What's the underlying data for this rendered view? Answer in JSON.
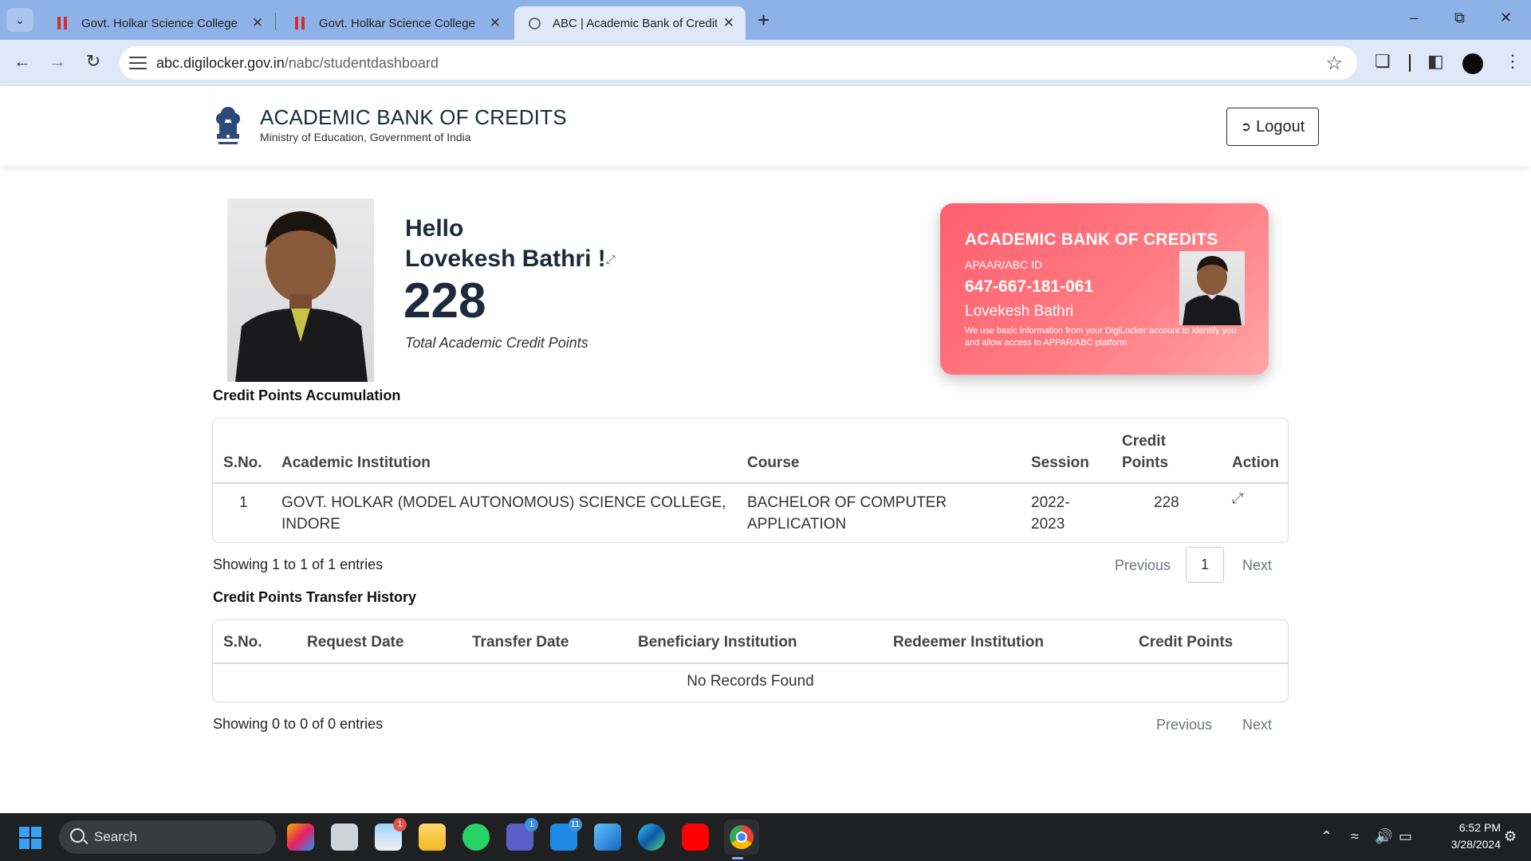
{
  "browser": {
    "tabs": [
      {
        "title": "Govt. Holkar Science College",
        "active": false
      },
      {
        "title": "Govt. Holkar Science College",
        "active": false
      },
      {
        "title": "ABC | Academic Bank of Credits",
        "active": true
      }
    ],
    "url_host": "abc.digilocker.gov.in",
    "url_path": "/nabc/studentdashboard"
  },
  "header": {
    "title": "ACADEMIC BANK OF CREDITS",
    "subtitle": "Ministry of Education, Government of India",
    "logout_label": "Logout"
  },
  "profile": {
    "greeting": "Hello",
    "name": "Lovekesh Bathri !",
    "total_credits": "228",
    "credits_caption": "Total Academic Credit Points"
  },
  "abc_card": {
    "title": "ACADEMIC BANK OF CREDITS",
    "id_label": "APAAR/ABC ID",
    "id_value": "647-667-181-061",
    "name": "Lovekesh Bathri",
    "note": "We use basic information from your DigiLocker account to identify you and allow access to APPAR/ABC platform",
    "gradient": [
      "#ff5f6d",
      "#ffa5a8"
    ]
  },
  "accumulation": {
    "heading": "Credit Points Accumulation",
    "columns": {
      "sno": "S.No.",
      "institution": "Academic Institution",
      "course": "Course",
      "session": "Session",
      "credit_line1": "Credit",
      "credit_line2": "Points",
      "action": "Action"
    },
    "rows": [
      {
        "sno": "1",
        "institution_line1": "GOVT. HOLKAR (MODEL AUTONOMOUS) SCIENCE COLLEGE,",
        "institution_line2": "INDORE",
        "course_line1": "BACHELOR OF COMPUTER",
        "course_line2": "APPLICATION",
        "session_line1": "2022-",
        "session_line2": "2023",
        "credit_points": "228",
        "action_icon": "expand-icon"
      }
    ],
    "info": "Showing 1 to 1 of 1 entries",
    "pager": {
      "previous": "Previous",
      "page": "1",
      "next": "Next"
    }
  },
  "transfer": {
    "heading": "Credit Points Transfer History",
    "columns": {
      "sno": "S.No.",
      "request_date": "Request Date",
      "transfer_date": "Transfer Date",
      "beneficiary": "Beneficiary Institution",
      "redeemer": "Redeemer Institution",
      "credit_points": "Credit Points"
    },
    "empty_text": "No Records Found",
    "info": "Showing 0 to 0 of 0 entries",
    "pager": {
      "previous": "Previous",
      "next": "Next"
    }
  },
  "taskbar": {
    "search_label": "Search",
    "apps": [
      {
        "name": "copilot-icon"
      },
      {
        "name": "task-view-icon"
      },
      {
        "name": "weather-icon",
        "badge": "1"
      },
      {
        "name": "file-explorer-icon"
      },
      {
        "name": "whatsapp-icon"
      },
      {
        "name": "teams-icon",
        "badge": "1"
      },
      {
        "name": "mail-icon",
        "badge": "11"
      },
      {
        "name": "photos-icon"
      },
      {
        "name": "edge-icon"
      },
      {
        "name": "youtube-icon"
      },
      {
        "name": "chrome-icon"
      }
    ],
    "time": "6:52 PM",
    "date": "3/28/2024"
  }
}
